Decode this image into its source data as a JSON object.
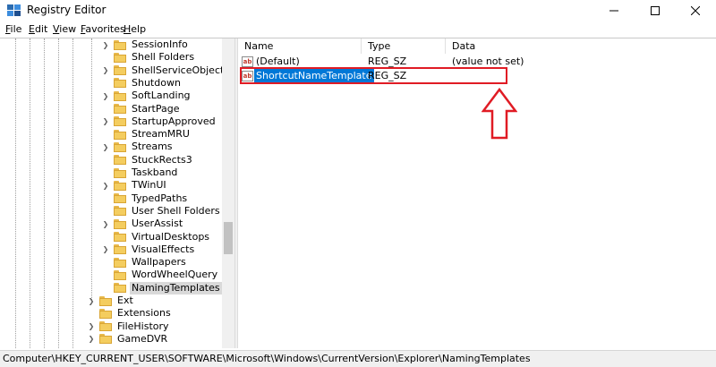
{
  "window": {
    "title": "Registry Editor",
    "minimize_icon": "minimize-icon",
    "maximize_icon": "maximize-icon",
    "close_icon": "close-icon"
  },
  "menu": [
    {
      "label": "File",
      "accel": "F",
      "rest": "ile"
    },
    {
      "label": "Edit",
      "accel": "E",
      "rest": "dit"
    },
    {
      "label": "View",
      "accel": "V",
      "rest": "iew"
    },
    {
      "label": "Favorites",
      "accel": "F",
      "rest": "avorites"
    },
    {
      "label": "Help",
      "accel": "H",
      "rest": "elp"
    }
  ],
  "tree": {
    "items": [
      {
        "label": "SessionInfo",
        "expandable": true
      },
      {
        "label": "Shell Folders",
        "expandable": false
      },
      {
        "label": "ShellServiceObjects",
        "expandable": true
      },
      {
        "label": "Shutdown",
        "expandable": false
      },
      {
        "label": "SoftLanding",
        "expandable": true
      },
      {
        "label": "StartPage",
        "expandable": false
      },
      {
        "label": "StartupApproved",
        "expandable": true
      },
      {
        "label": "StreamMRU",
        "expandable": false
      },
      {
        "label": "Streams",
        "expandable": true
      },
      {
        "label": "StuckRects3",
        "expandable": false
      },
      {
        "label": "Taskband",
        "expandable": false
      },
      {
        "label": "TWinUI",
        "expandable": true
      },
      {
        "label": "TypedPaths",
        "expandable": false
      },
      {
        "label": "User Shell Folders",
        "expandable": false
      },
      {
        "label": "UserAssist",
        "expandable": true
      },
      {
        "label": "VirtualDesktops",
        "expandable": false
      },
      {
        "label": "VisualEffects",
        "expandable": true
      },
      {
        "label": "Wallpapers",
        "expandable": false
      },
      {
        "label": "WordWheelQuery",
        "expandable": false
      },
      {
        "label": "NamingTemplates",
        "expandable": false,
        "selected": true
      }
    ],
    "parent_items": [
      {
        "label": "Ext",
        "expandable": true
      },
      {
        "label": "Extensions",
        "expandable": false
      },
      {
        "label": "FileHistory",
        "expandable": true
      },
      {
        "label": "GameDVR",
        "expandable": true
      }
    ]
  },
  "list": {
    "columns": [
      "Name",
      "Type",
      "Data"
    ],
    "rows": [
      {
        "name": "(Default)",
        "type": "REG_SZ",
        "data": "(value not set)",
        "icon": "string-value-icon"
      },
      {
        "name": "ShortcutNameTemplate",
        "type": "REG_SZ",
        "data": "",
        "icon": "string-value-icon",
        "selected": true
      }
    ]
  },
  "status": {
    "path": "Computer\\HKEY_CURRENT_USER\\SOFTWARE\\Microsoft\\Windows\\CurrentVersion\\Explorer\\NamingTemplates"
  },
  "colors": {
    "selection": "#0078d7",
    "annotation": "#e01b24",
    "folder": "#f4cd5f"
  }
}
